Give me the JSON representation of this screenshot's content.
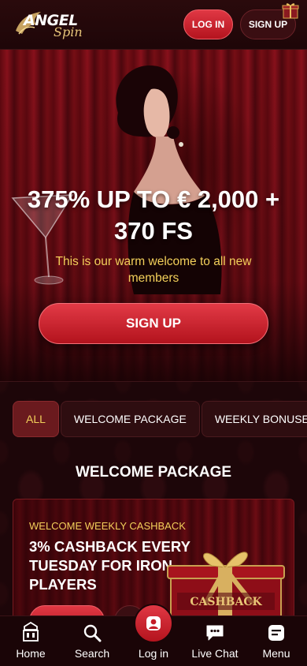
{
  "header": {
    "logo_top": "ANGEL",
    "logo_bottom": "Spin",
    "login_label": "LOG IN",
    "signup_label": "SIGN UP"
  },
  "hero": {
    "title": "375% UP TO € 2,000 + 370 FS",
    "subtitle": "This is our warm welcome to all new members",
    "cta_label": "SIGN UP"
  },
  "tabs": [
    {
      "label": "ALL",
      "active": true
    },
    {
      "label": "WELCOME PACKAGE",
      "active": false
    },
    {
      "label": "WEEKLY BONUSES",
      "active": false
    }
  ],
  "section": {
    "title": "WELCOME PACKAGE"
  },
  "promo_card": {
    "kicker": "WELCOME WEEKLY CASHBACK",
    "title": "3% CASHBACK EVERY TUESDAY FOR IRON PLAYERS",
    "box_label": "CASHBACK"
  },
  "bottom_nav": [
    {
      "label": "Home",
      "icon": "casino-icon"
    },
    {
      "label": "Search",
      "icon": "search-icon"
    },
    {
      "label": "Log in",
      "icon": "user-icon"
    },
    {
      "label": "Live Chat",
      "icon": "chat-icon"
    },
    {
      "label": "Menu",
      "icon": "menu-icon"
    }
  ],
  "colors": {
    "accent_red": "#d42a36",
    "gold_text": "#f2cf5a",
    "background": "#1a0608"
  }
}
